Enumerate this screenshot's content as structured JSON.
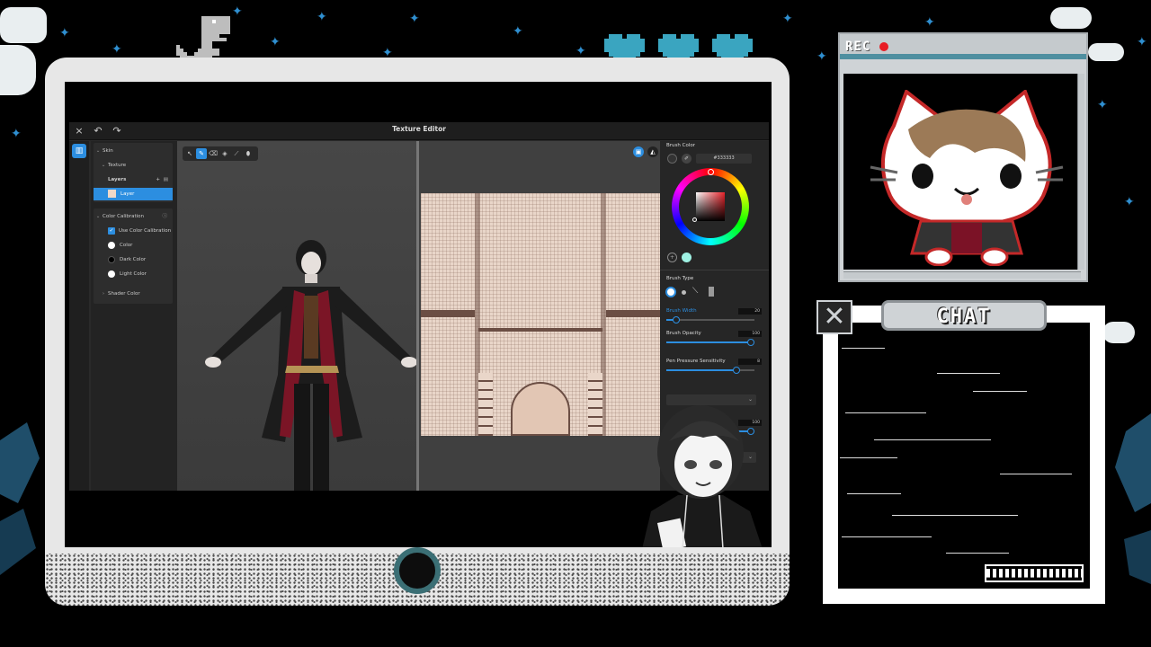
{
  "app": {
    "title": "Texture Editor",
    "close_icon": "×",
    "undo_icon": "↶",
    "redo_icon": "↷",
    "rail_icon": "▥"
  },
  "side_panel": {
    "skin_label": "Skin",
    "texture_label": "Texture",
    "layers_label": "Layers",
    "layer_item": "Layer",
    "color_calibration_label": "Color Calibration",
    "use_color_calibration": "Use Color Calibration",
    "color_label": "Color",
    "dark_color_label": "Dark Color",
    "light_color_label": "Light Color",
    "shader_color_label": "Shader Color"
  },
  "brush_panel": {
    "brush_color_label": "Brush Color",
    "hex_value": "#333333",
    "brush_type_label": "Brush Type",
    "brush_width_label": "Brush Width",
    "brush_width_value": "20",
    "brush_opacity_label": "Brush Opacity",
    "brush_opacity_value": "100",
    "pen_pressure_label": "Pen Pressure Sensitivity",
    "pen_pressure_value": "8",
    "extra_value": "100",
    "colors": {
      "accent": "#2c8ee0",
      "selected_color": "#e8232a"
    }
  },
  "overlay": {
    "rec_label": "REC",
    "chat_label": "CHAT",
    "close_icon": "✕"
  }
}
